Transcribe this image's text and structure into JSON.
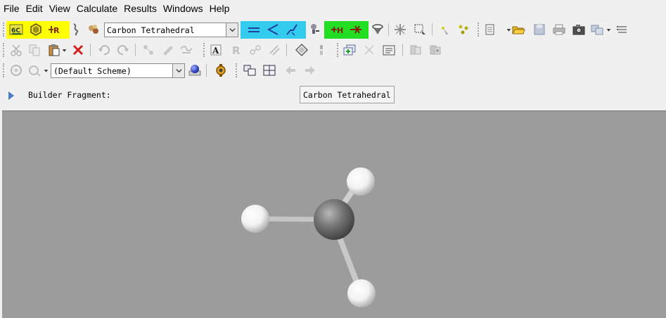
{
  "menubar": {
    "items": [
      "File",
      "Edit",
      "View",
      "Calculate",
      "Results",
      "Windows",
      "Help"
    ]
  },
  "toolbar": {
    "fragment_combo_value": "Carbon Tetrahedral",
    "scheme_combo_value": "(Default Scheme)",
    "highlight_colors": {
      "yellow": "#ffff00",
      "cyan": "#33ccee",
      "green": "#22dd22"
    },
    "row1_icons": [
      "element-fragment-icon",
      "ring-fragment-icon",
      "r-group-fragment-icon",
      "custom-fragment-icon",
      "biological-fragment-icon",
      "modify-bond-icon",
      "modify-angle-icon",
      "modify-dihedral-icon",
      "inquire-icon",
      "add-valence-icon",
      "delete-atom-icon",
      "clean-icon",
      "rebuild-icon",
      "select-atom-icon",
      "select-region-icon",
      "mirror-icon",
      "symmetrize-icon",
      "new-icon",
      "open-icon",
      "save-icon",
      "print-icon",
      "save-image-icon",
      "window-icon",
      "list-icon"
    ],
    "row2_icons": [
      "cut-icon",
      "copy-icon",
      "paste-icon",
      "delete-icon",
      "undo-icon",
      "redo-icon",
      "invert-icon",
      "rotate-icon",
      "translate-icon",
      "text-icon",
      "r-icon",
      "link-icon",
      "stack-icon",
      "diamond-icon",
      "spring-icon",
      "add-window-icon",
      "close-window-icon",
      "tile-icon",
      "layers-icon",
      "layers-alt-icon"
    ],
    "row3_icons": [
      "display-icon",
      "display-alt-icon",
      "color-sphere-icon",
      "settings-icon",
      "windows-icon",
      "grid-icon",
      "back-arrow-icon",
      "forward-arrow-icon"
    ]
  },
  "fragment_bar": {
    "label": "Builder Fragment:",
    "value": "Carbon Tetrahedral"
  },
  "viewport": {
    "background_color": "#9c9c9c",
    "molecule": {
      "atoms": [
        {
          "element": "C",
          "color": "#707070"
        },
        {
          "element": "H",
          "color": "#ffffff"
        },
        {
          "element": "H",
          "color": "#ffffff"
        },
        {
          "element": "H",
          "color": "#ffffff"
        }
      ]
    }
  }
}
